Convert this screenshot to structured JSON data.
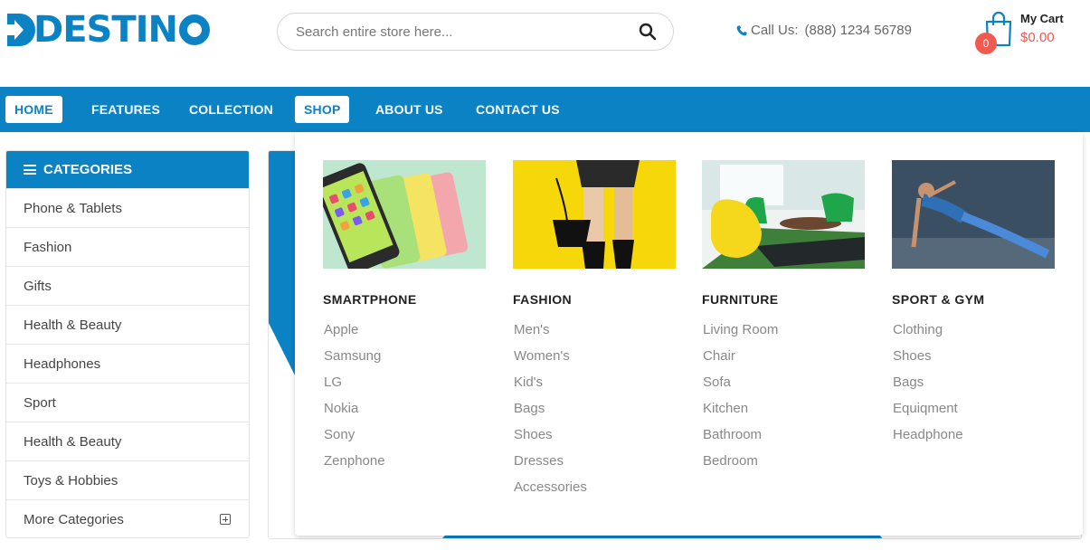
{
  "brand": {
    "name": "DESTIN",
    "accent_color": "#0a82c4",
    "sale_color": "#f15a4f"
  },
  "search": {
    "placeholder": "Search entire store here..."
  },
  "contact": {
    "label": "Call Us:",
    "phone": "(888) 1234 56789"
  },
  "cart": {
    "title": "My Cart",
    "total": "$0.00",
    "count": "0"
  },
  "nav": {
    "items": [
      {
        "label": "HOME",
        "active": true
      },
      {
        "label": "FEATURES",
        "active": false
      },
      {
        "label": "COLLECTION",
        "active": false
      },
      {
        "label": "SHOP",
        "active": true
      },
      {
        "label": "ABOUT US",
        "active": false
      },
      {
        "label": "CONTACT US",
        "active": false
      }
    ]
  },
  "sidebar": {
    "title": "CATEGORIES",
    "items": [
      {
        "label": "Phone & Tablets"
      },
      {
        "label": "Fashion"
      },
      {
        "label": "Gifts"
      },
      {
        "label": "Health & Beauty"
      },
      {
        "label": "Headphones"
      },
      {
        "label": "Sport"
      },
      {
        "label": "Health & Beauty"
      },
      {
        "label": "Toys & Hobbies"
      },
      {
        "label": "More Categories"
      }
    ]
  },
  "mega_menu": {
    "columns": [
      {
        "title": "SMARTPHONE",
        "image": "smartphones-image",
        "links": [
          "Apple",
          "Samsung",
          "LG",
          "Nokia",
          "Sony",
          "Zenphone"
        ]
      },
      {
        "title": "FASHION",
        "image": "fashion-handbag-image",
        "links": [
          "Men's",
          "Women's",
          "Kid's",
          "Bags",
          "Shoes",
          "Dresses",
          "Accessories"
        ]
      },
      {
        "title": "FURNITURE",
        "image": "living-room-furniture-image",
        "links": [
          "Living Room",
          "Chair",
          "Sofa",
          "Kitchen",
          "Bathroom",
          "Bedroom"
        ]
      },
      {
        "title": "SPORT & GYM",
        "image": "fitness-woman-image",
        "links": [
          "Clothing",
          "Shoes",
          "Bags",
          "Equiqment",
          "Headphone"
        ]
      }
    ]
  }
}
